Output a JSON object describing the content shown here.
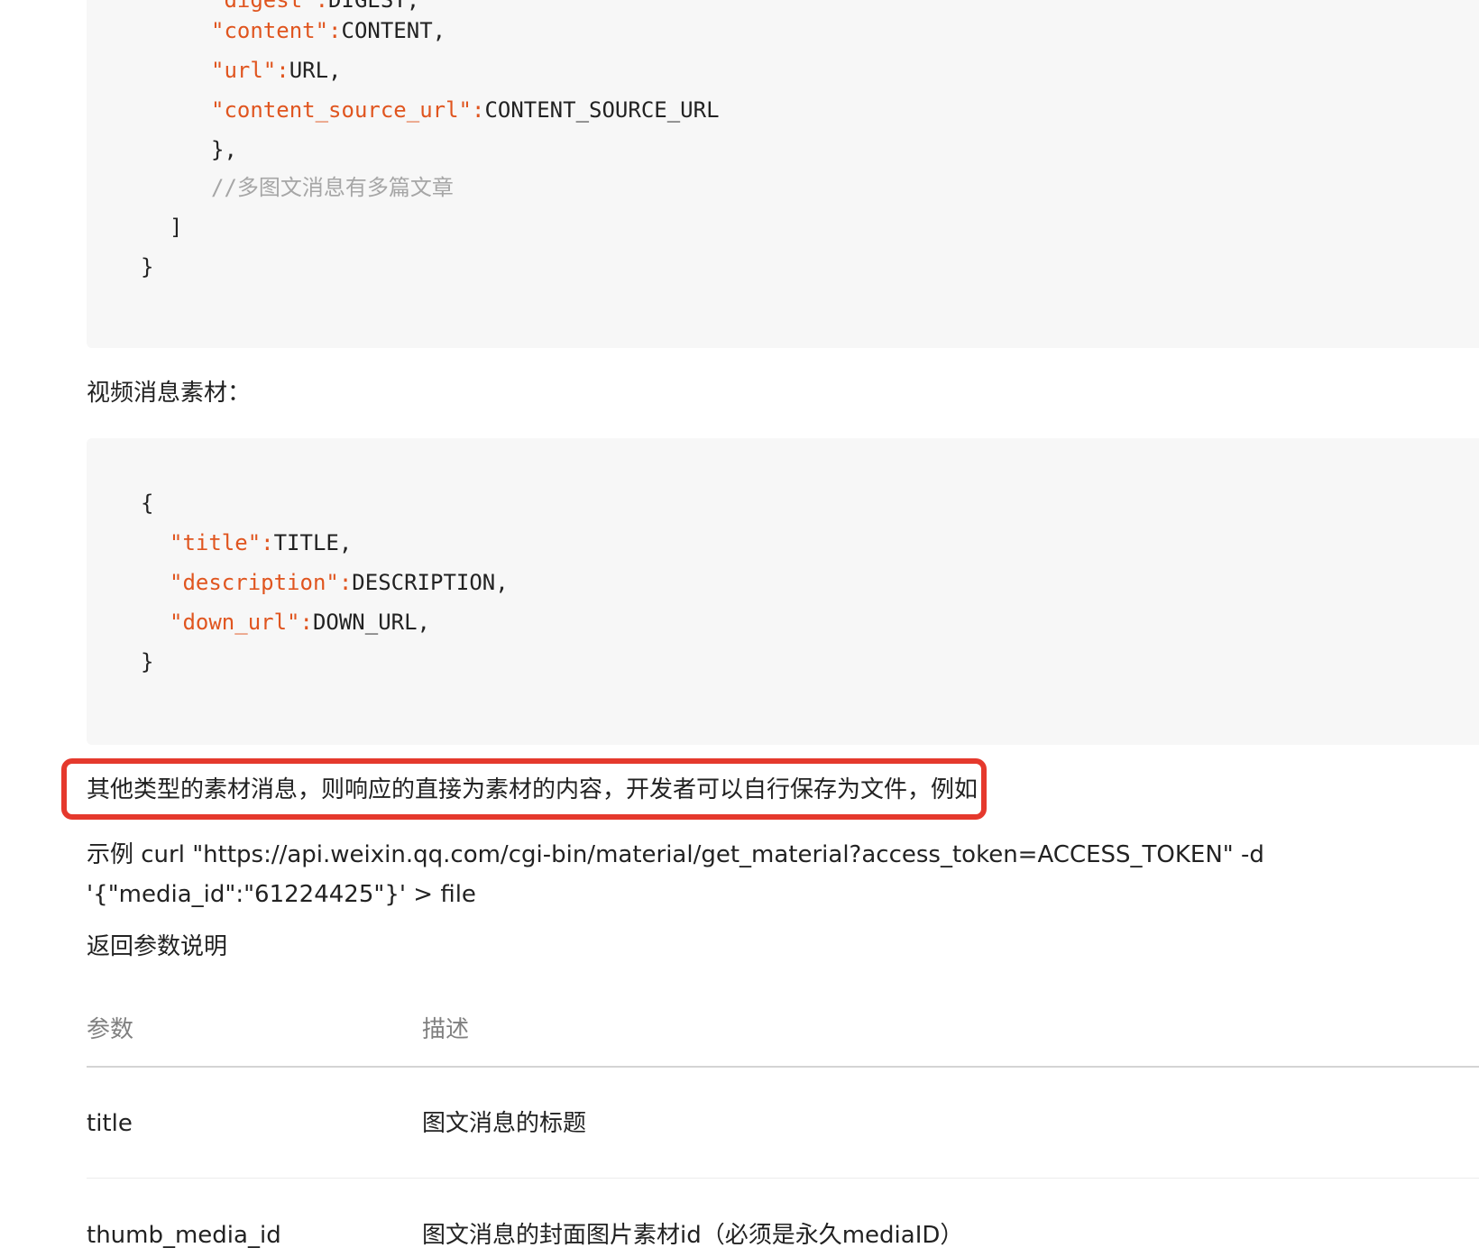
{
  "code_block_1": {
    "lines": [
      {
        "key": "\"digest\":",
        "value": "DIGEST,"
      },
      {
        "key": "\"content\":",
        "value": "CONTENT,"
      },
      {
        "key": "\"url\":",
        "value": "URL,"
      },
      {
        "key": "\"content_source_url\":",
        "value": "CONTENT_SOURCE_URL"
      },
      {
        "text": "},"
      },
      {
        "comment": "//多图文消息有多篇文章"
      },
      {
        "text": "]"
      },
      {
        "text": "}"
      }
    ]
  },
  "video_heading": "视频消息素材：",
  "code_block_2": {
    "lines": [
      {
        "text": "{"
      },
      {
        "key": "\"title\":",
        "value": "TITLE,"
      },
      {
        "key": "\"description\":",
        "value": "DESCRIPTION,"
      },
      {
        "key": "\"down_url\":",
        "value": "DOWN_URL,"
      },
      {
        "text": "}"
      }
    ]
  },
  "other_types_text": "其他类型的素材消息，则响应的直接为素材的内容，开发者可以自行保存为文件，例如：",
  "example_line_1": "示例 curl \"https://api.weixin.qq.com/cgi-bin/material/get_material?access_token=ACCESS_TOKEN\" -d",
  "example_line_2": "'{\"media_id\":\"61224425\"}' > file",
  "return_params_heading": "返回参数说明",
  "table": {
    "headers": [
      "参数",
      "描述"
    ],
    "rows": [
      [
        "title",
        "图文消息的标题"
      ],
      [
        "thumb_media_id",
        "图文消息的封面图片素材id（必须是永久mediaID）"
      ]
    ]
  },
  "colors": {
    "code_key": "#e0551f",
    "comment": "#a6a6a6",
    "highlight_border": "#e5392d",
    "code_bg": "#f7f7f7"
  }
}
